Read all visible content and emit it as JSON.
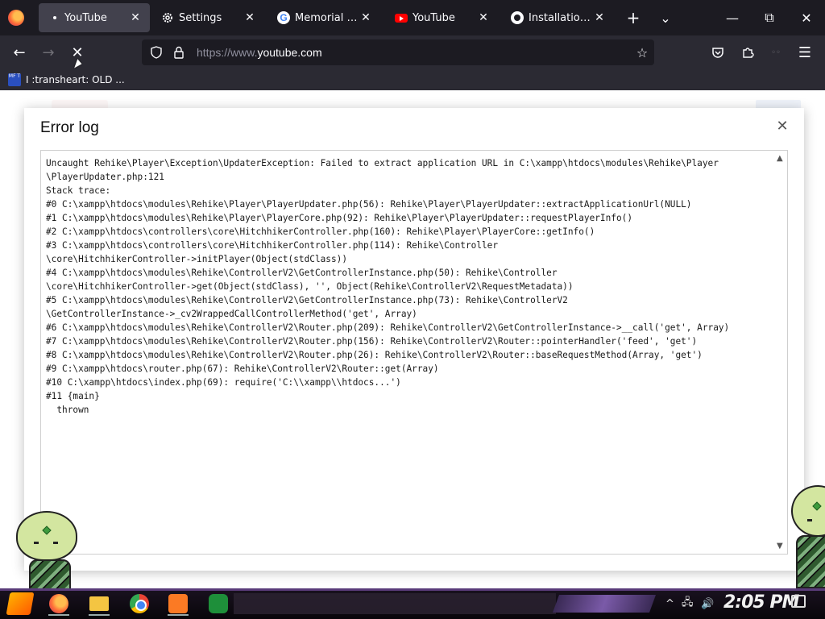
{
  "tabs": [
    {
      "label": "YouTube",
      "icon": "loading-dot-icon",
      "active": true
    },
    {
      "label": "Settings",
      "icon": "gear-icon"
    },
    {
      "label": "Memorial Day -",
      "icon": "google-icon"
    },
    {
      "label": "YouTube",
      "icon": "youtube-icon"
    },
    {
      "label": "Installation · Re",
      "icon": "github-icon"
    }
  ],
  "window_controls": {
    "minimize": "—",
    "maximize": "⧉",
    "close": "✕"
  },
  "tab_plus": "+",
  "tab_list": "⌄",
  "nav": {
    "back": "←",
    "forward": "→",
    "stop": "✕"
  },
  "url": {
    "scheme_prefix": "https://www.",
    "host": "youtube.com"
  },
  "toolbar_icons": [
    "pocket-icon",
    "extensions-icon",
    "menu-icon"
  ],
  "bookmark": {
    "favicon_text": "MF T",
    "label": "I :transheart: OLD ..."
  },
  "dialog": {
    "title": "Error log",
    "close": "✕",
    "log": "Uncaught Rehike\\Player\\Exception\\UpdaterException: Failed to extract application URL in C:\\xampp\\htdocs\\modules\\Rehike\\Player\n\\PlayerUpdater.php:121\nStack trace:\n#0 C:\\xampp\\htdocs\\modules\\Rehike\\Player\\PlayerUpdater.php(56): Rehike\\Player\\PlayerUpdater::extractApplicationUrl(NULL)\n#1 C:\\xampp\\htdocs\\modules\\Rehike\\Player\\PlayerCore.php(92): Rehike\\Player\\PlayerUpdater::requestPlayerInfo()\n#2 C:\\xampp\\htdocs\\controllers\\core\\HitchhikerController.php(160): Rehike\\Player\\PlayerCore::getInfo()\n#3 C:\\xampp\\htdocs\\controllers\\core\\HitchhikerController.php(114): Rehike\\Controller\n\\core\\HitchhikerController->initPlayer(Object(stdClass))\n#4 C:\\xampp\\htdocs\\modules\\Rehike\\ControllerV2\\GetControllerInstance.php(50): Rehike\\Controller\n\\core\\HitchhikerController->get(Object(stdClass), '', Object(Rehike\\ControllerV2\\RequestMetadata))\n#5 C:\\xampp\\htdocs\\modules\\Rehike\\ControllerV2\\GetControllerInstance.php(73): Rehike\\ControllerV2\n\\GetControllerInstance->_cv2WrappedCallControllerMethod('get', Array)\n#6 C:\\xampp\\htdocs\\modules\\Rehike\\ControllerV2\\Router.php(209): Rehike\\ControllerV2\\GetControllerInstance->__call('get', Array)\n#7 C:\\xampp\\htdocs\\modules\\Rehike\\ControllerV2\\Router.php(156): Rehike\\ControllerV2\\Router::pointerHandler('feed', 'get')\n#8 C:\\xampp\\htdocs\\modules\\Rehike\\ControllerV2\\Router.php(26): Rehike\\ControllerV2\\Router::baseRequestMethod(Array, 'get')\n#9 C:\\xampp\\htdocs\\router.php(67): Rehike\\ControllerV2\\Router::get(Array)\n#10 C:\\xampp\\htdocs\\index.php(69): require('C:\\\\xampp\\\\htdocs...')\n#11 {main}\n  thrown"
  },
  "taskbar": {
    "apps": [
      "firefox-icon",
      "file-explorer-icon",
      "chrome-icon",
      "xampp-icon",
      "green-app-icon"
    ],
    "tray": {
      "chevron": "^",
      "network": "🖧",
      "volume": "🔊"
    },
    "clock": "2:05 PM"
  }
}
